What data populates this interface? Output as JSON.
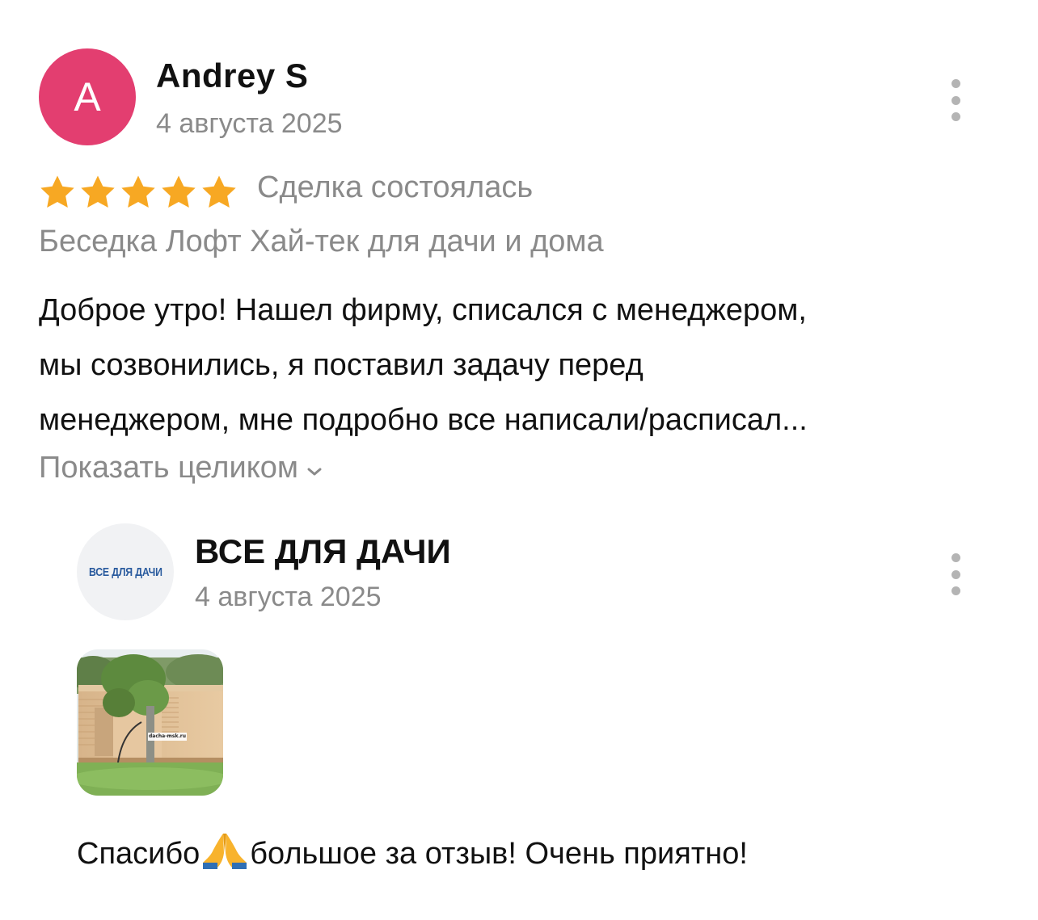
{
  "review": {
    "author": {
      "initial": "A",
      "name": "Andrey S",
      "avatar_color": "#e33e70"
    },
    "date": "4 августа 2025",
    "rating": 5,
    "rating_max": 5,
    "star_color": "#f7a823",
    "deal_status": "Сделка состоялась",
    "product_title": "Беседка Лофт Хай-тек для дачи и дома",
    "text": "Доброе утро! Нашел фирму, списался с менеджером,\nмы созвонились, я поставил задачу перед\nменеджером, мне подробно все написали/расписал...",
    "show_more_label": "Показать целиком",
    "show_more_icon": "chevron-down-icon",
    "menu_icon": "more-vertical-icon"
  },
  "reply": {
    "logo_text": "ВСЕ ДЛЯ ДАЧИ",
    "logo_color": "#2a5b9e",
    "shop_name": "ВСЕ ДЛЯ ДАЧИ",
    "date": "4 августа 2025",
    "photo_watermark": "dacha-msk.ru",
    "text_before_emoji": "Спасибо",
    "emoji_icon": "folded-hands-icon",
    "text_after_emoji": "большое за отзыв! Очень приятно!",
    "menu_icon": "more-vertical-icon"
  }
}
